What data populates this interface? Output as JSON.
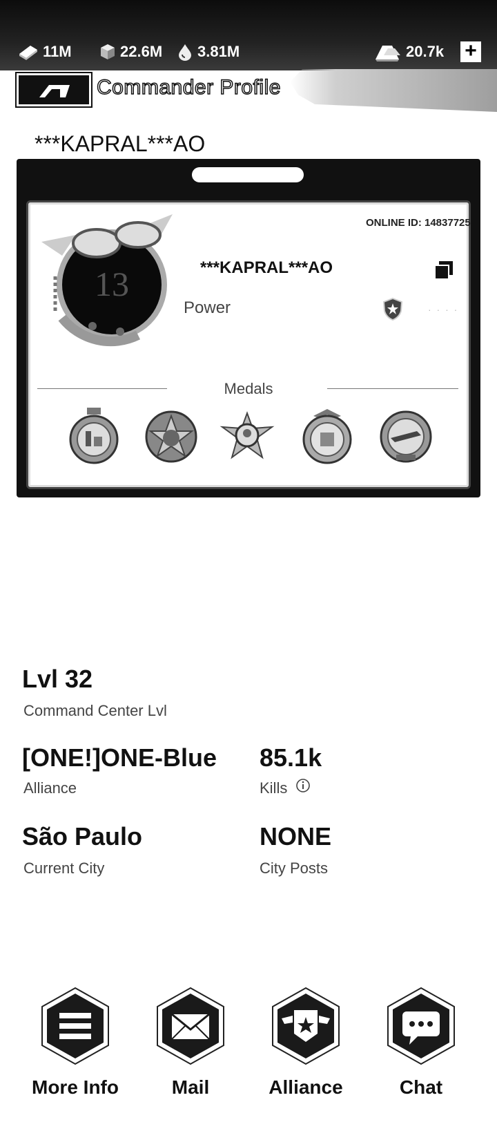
{
  "resources": {
    "cash": "11M",
    "steel": "22.6M",
    "oil": "3.81M",
    "premium": "20.7k",
    "plus_label": "+"
  },
  "header": {
    "title": "Commander Profile"
  },
  "player": {
    "name": "***KAPRAL***AO",
    "card_name": "***KAPRAL***AO",
    "online_id": "ONLINE ID: 14837725",
    "power_label": "Power",
    "power_value": "· · · ·",
    "avatar_number": "13"
  },
  "medals": {
    "title": "Medals",
    "items": [
      "medal-1",
      "medal-2",
      "medal-3",
      "medal-4",
      "medal-5"
    ]
  },
  "stats": {
    "level_value": "Lvl 32",
    "level_label": "Command Center Lvl",
    "alliance_value": "[ONE!]ONE-Blue",
    "alliance_label": "Alliance",
    "kills_value": "85.1k",
    "kills_label": "Kills",
    "city_value": "São Paulo",
    "city_label": "Current City",
    "posts_value": "NONE",
    "posts_label": "City Posts"
  },
  "nav": {
    "more_info": "More Info",
    "mail": "Mail",
    "alliance": "Alliance",
    "chat": "Chat"
  }
}
